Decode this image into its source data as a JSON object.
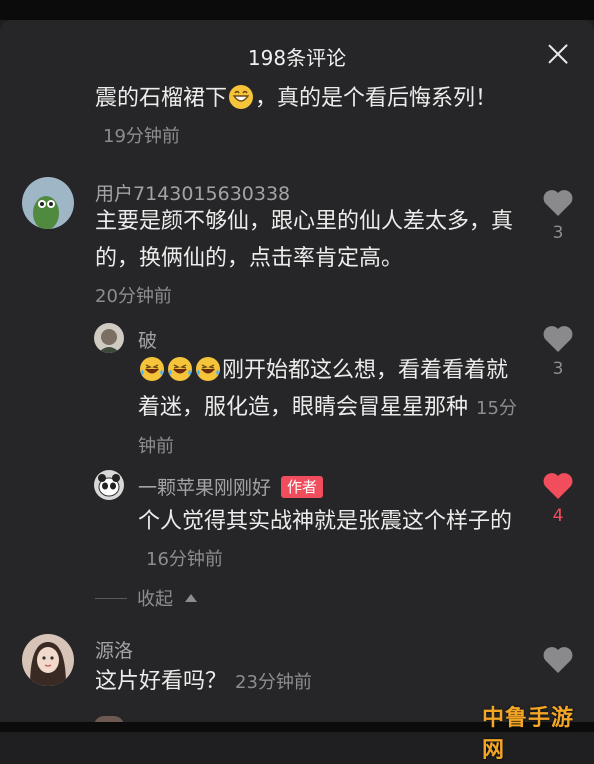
{
  "header": {
    "title": "198条评论",
    "close_icon": "close-icon"
  },
  "comments": [
    {
      "text": "震的石榴裙下😁，真的是个看后悔系列！",
      "time": "19分钟前"
    },
    {
      "user": "用户7143015630338",
      "text": "主要是颜不够仙，跟心里的仙人差太多，真的，换俩仙的，点击率肯定高。",
      "time": "20分钟前",
      "likes": "3"
    },
    {
      "user": "破",
      "text": "刚开始都这么想，看着看着就着迷，服化造，眼睛会冒星星那种",
      "emojis": "😂😂😂",
      "time": "15分钟前",
      "likes": "3"
    },
    {
      "user": "一颗苹果刚刚好",
      "badge": "作者",
      "text": "个人觉得其实战神就是张震这个样子的",
      "time": "16分钟前",
      "likes": "4"
    },
    {
      "user": "源洛",
      "text": "这片好看吗？",
      "time": "23分钟前"
    }
  ],
  "collapse_label": "收起",
  "partial_user": "...",
  "watermark": "中鲁手游网",
  "colors": {
    "like_active": "#f24d5c",
    "background": "#262628"
  }
}
